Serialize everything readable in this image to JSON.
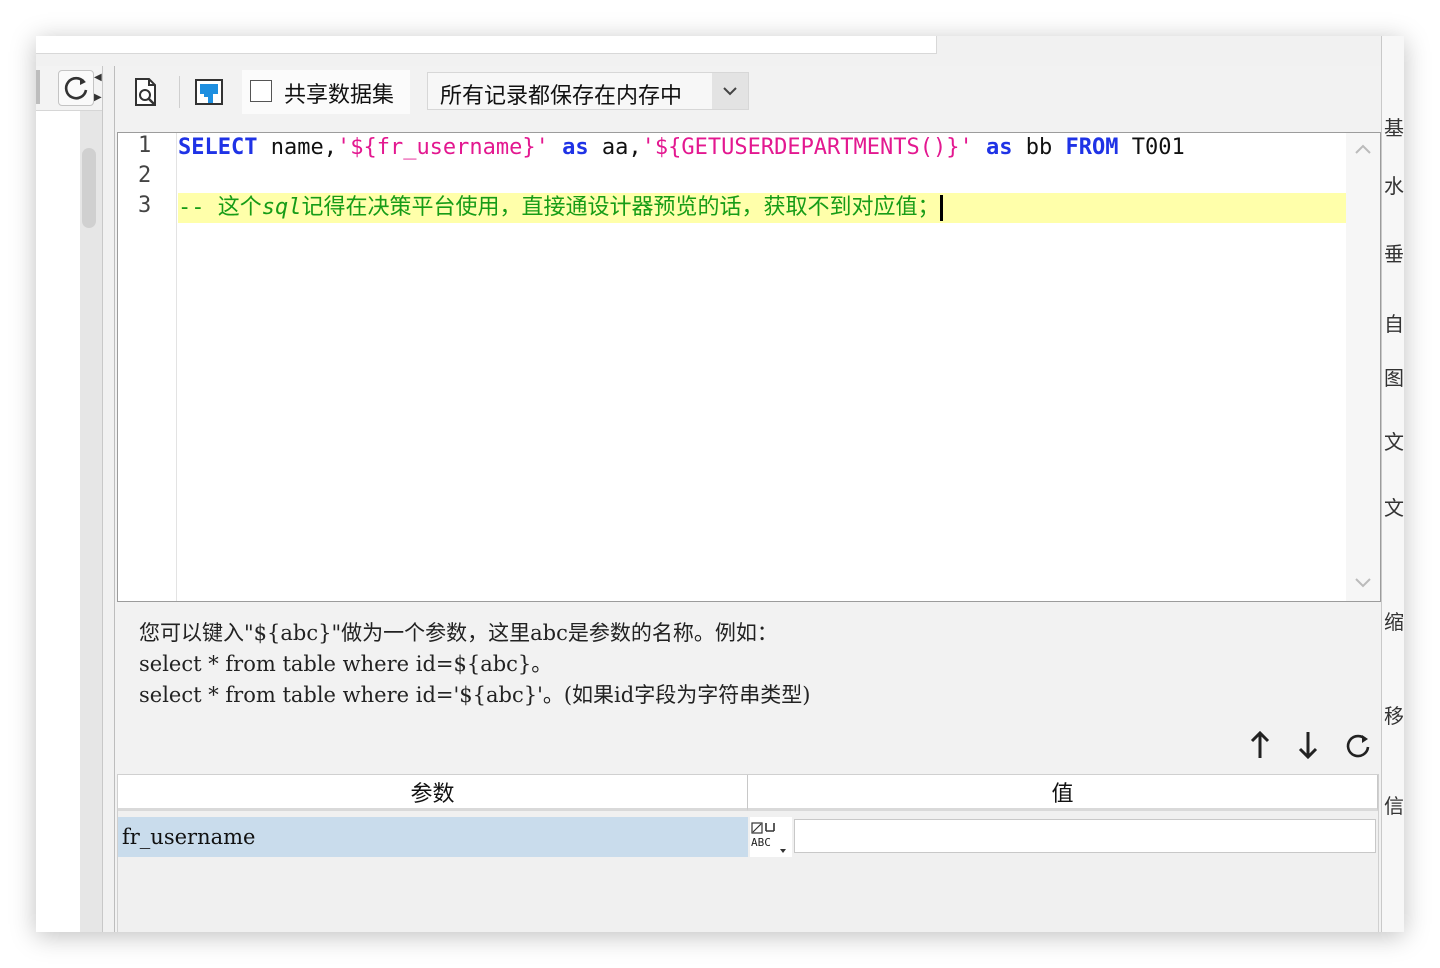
{
  "toolbar": {
    "share_dataset_label": "共享数据集",
    "share_dataset_checked": false,
    "storage_select_value": "所有记录都保存在内存中"
  },
  "editor": {
    "line_numbers": [
      "1",
      "2",
      "3"
    ],
    "line1": {
      "kw_select": "SELECT",
      "t1": " name,",
      "s1": "'${fr_username}'",
      "t2": " ",
      "kw_as1": "as",
      "t3": " aa,",
      "s2": "'${GETUSERDEPARTMENTS()}'",
      "t4": " ",
      "kw_as2": "as",
      "t5": " bb ",
      "kw_from": "FROM",
      "t6": " T001"
    },
    "line3": {
      "c1": "-- 这个",
      "c2": "sql",
      "c3": "记得在决策平台使用，直接通设计器预览的话，获取不到对应值；"
    }
  },
  "help": {
    "line1": "您可以键入\"${abc}\"做为一个参数，这里abc是参数的名称。例如：",
    "line2": "select * from table where id=${abc}。",
    "line3": "select * from table where id='${abc}'。(如果id字段为字符串类型)"
  },
  "param_table": {
    "col_param": "参数",
    "col_value": "值",
    "rows": [
      {
        "name": "fr_username",
        "value": ""
      }
    ]
  },
  "right_panel_chars": [
    "基",
    "水",
    "垂",
    "自",
    "图",
    "文",
    "文",
    "缩",
    "移",
    "信"
  ],
  "colors": {
    "keyword": "#1f33e6",
    "string": "#e31890",
    "comment": "#179c17",
    "highlight_line": "#ffffaa",
    "selected_row": "#c9dcec"
  }
}
